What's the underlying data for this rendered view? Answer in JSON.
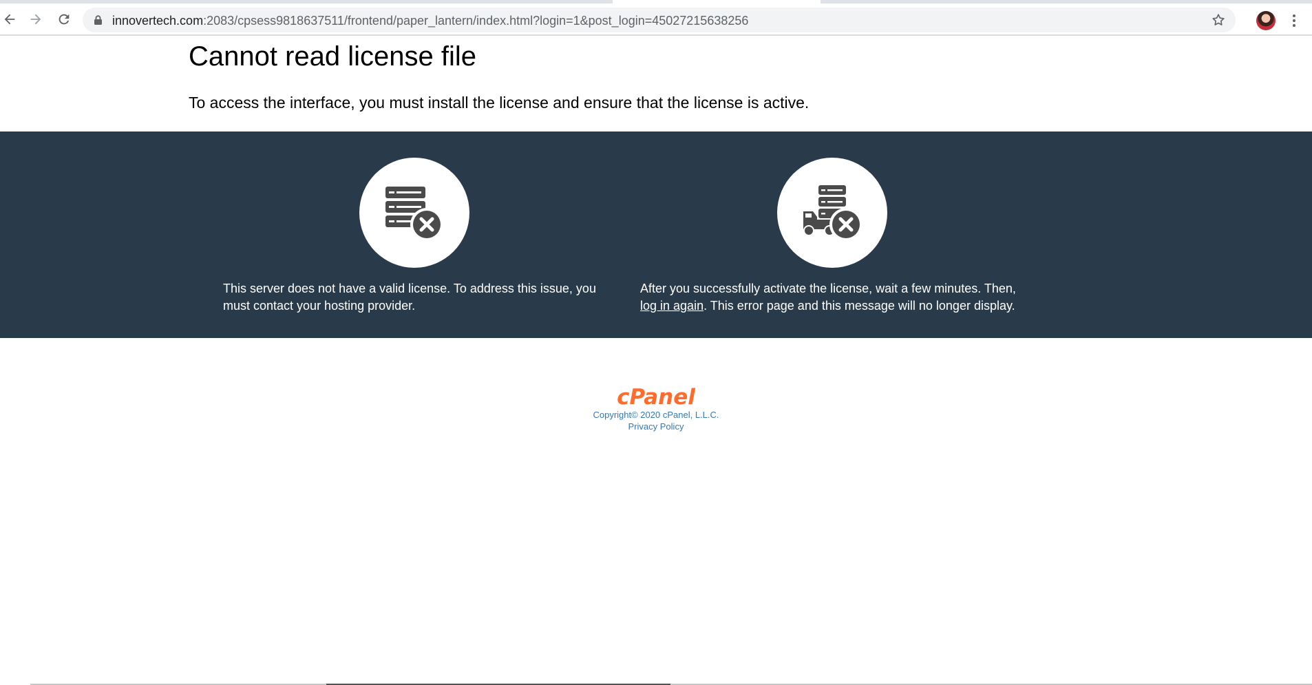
{
  "browser": {
    "url_host": "innovertech.com",
    "url_rest": ":2083/cpsess9818637511/frontend/paper_lantern/index.html?login=1&post_login=45027215638256",
    "icons": {
      "back": "arrow-left-icon",
      "forward": "arrow-right-icon",
      "reload": "reload-icon",
      "lock": "lock-icon",
      "bookmark": "star-icon",
      "menu": "three-dots-icon"
    }
  },
  "page": {
    "title": "Cannot read license file",
    "intro": "To access the interface, you must install the license and ensure that the license is active."
  },
  "panels": {
    "left": {
      "icon": "server-error-icon",
      "text": "This server does not have a valid license. To address this issue, you must contact your hosting provider."
    },
    "right": {
      "icon": "truck-server-error-icon",
      "text_before": "After you successfully activate the license, wait a few minutes. Then, ",
      "link_text": "log in again",
      "text_after": ". This error page and this message will no longer display."
    }
  },
  "footer": {
    "logo_text": "cPanel",
    "copyright": "Copyright© 2020 cPanel, L.L.C.",
    "privacy_link": "Privacy Policy"
  },
  "colors": {
    "band_bg": "#293a4a",
    "logo": "#ff6c2c",
    "footer_link": "#337ab7",
    "icon_fill": "#4a4a4a"
  }
}
